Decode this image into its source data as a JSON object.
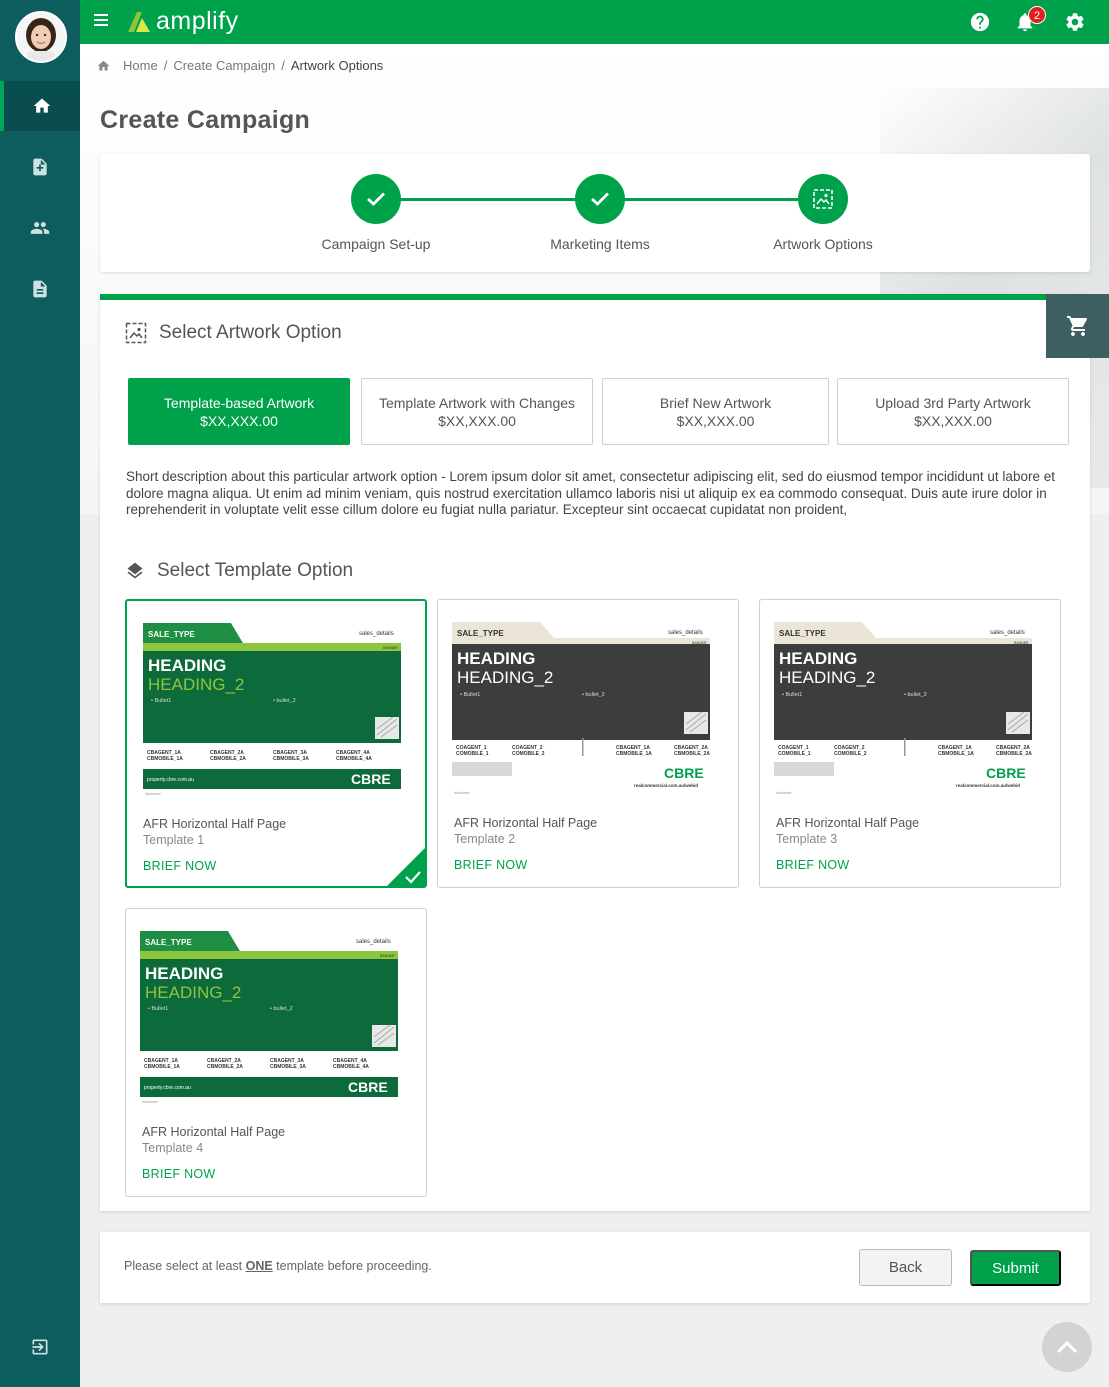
{
  "app": {
    "logo_text": "amplify"
  },
  "header": {
    "notification_count": "2"
  },
  "breadcrumb": {
    "home": "Home",
    "create": "Create Campaign",
    "current": "Artwork Options"
  },
  "page": {
    "title": "Create Campaign"
  },
  "stepper": {
    "steps": [
      {
        "label": "Campaign Set-up",
        "status": "complete"
      },
      {
        "label": "Marketing Items",
        "status": "complete"
      },
      {
        "label": "Artwork Options",
        "status": "active"
      }
    ]
  },
  "artwork_section": {
    "title": "Select Artwork Option",
    "options": [
      {
        "label": "Template-based Artwork",
        "price": "$XX,XXX.00",
        "selected": true
      },
      {
        "label": "Template Artwork with Changes",
        "price": "$XX,XXX.00",
        "selected": false
      },
      {
        "label": "Brief New Artwork",
        "price": "$XX,XXX.00",
        "selected": false
      },
      {
        "label": "Upload 3rd Party Artwork",
        "price": "$XX,XXX.00",
        "selected": false
      }
    ],
    "description": "Short description about this particular artwork option - Lorem ipsum dolor sit amet, consectetur adipiscing elit, sed do eiusmod tempor incididunt ut labore et dolore magna aliqua. Ut enim ad minim veniam, quis nostrud exercitation ullamco laboris nisi ut aliquip ex ea commodo consequat. Duis aute irure dolor in reprehenderit in voluptate velit esse cillum dolore eu fugiat nulla pariatur. Excepteur sint occaecat cupidatat non proident,"
  },
  "template_section": {
    "title": "Select Template Option",
    "templates": [
      {
        "name": "AFR Horizontal Half Page",
        "sub": "Template 1",
        "action": "BRIEF NOW",
        "selected": true,
        "thumb": {
          "sale_type": "SALE_TYPE",
          "sales_details": "sales_details",
          "banner": "BANNER",
          "heading": "HEADING",
          "heading2": "HEADING_2",
          "bullet1": "• Bullet1",
          "bullet2": "• bullet_2",
          "agent1": "CBAGENT_1A",
          "mobile1": "CBMOBILE_1A",
          "agent2": "CBAGENT_2A",
          "mobile2": "CBMOBILE_2A",
          "agent3": "CBAGENT_3A",
          "mobile3": "CBMOBILE_3A",
          "agent4": "CBAGENT_4A",
          "mobile4": "CBMOBILE_4A",
          "url": "property.cbre.com.au",
          "brand": "CBRE",
          "disclaimer": "disclaimer"
        }
      },
      {
        "name": "AFR Horizontal Half Page",
        "sub": "Template 2",
        "action": "BRIEF NOW",
        "selected": false,
        "thumb": {
          "sale_type": "SALE_TYPE",
          "sales_details": "sales_details",
          "banner": "BANNER",
          "heading": "HEADING",
          "heading2": "HEADING_2",
          "bullet1": "• Bullet1",
          "bullet2": "• bullet_2",
          "agent1": "COAGENT_1",
          "mobile1": "COMOBILE_1",
          "agent2": "COAGENT_2",
          "mobile2": "COMOBILE_2",
          "agent3": "CBAGENT_1A",
          "mobile3": "CBMOBILE_1A",
          "agent4": "CBAGENT_2A",
          "mobile4": "CBMOBILE_2A",
          "url": "realcommercial.com.au/webid",
          "brand": "CBRE",
          "disclaimer": "disclaimer"
        }
      },
      {
        "name": "AFR Horizontal Half Page",
        "sub": "Template 3",
        "action": "BRIEF NOW",
        "selected": false,
        "thumb": {
          "sale_type": "SALE_TYPE",
          "sales_details": "sales_details",
          "banner": "BANNER",
          "heading": "HEADING",
          "heading2": "HEADING_2",
          "bullet1": "• Bullet1",
          "bullet2": "• bullet_2",
          "agent1": "COAGENT_1",
          "mobile1": "COMOBILE_1",
          "agent2": "COAGENT_2",
          "mobile2": "COMOBILE_2",
          "agent3": "CBAGENT_1A",
          "mobile3": "CBMOBILE_1A",
          "agent4": "CBAGENT_2A",
          "mobile4": "CBMOBILE_2A",
          "url": "realcommercial.com.au/webid",
          "brand": "CBRE",
          "disclaimer": "disclaimer"
        }
      },
      {
        "name": "AFR Horizontal Half Page",
        "sub": "Template 4",
        "action": "BRIEF NOW",
        "selected": false,
        "thumb": {
          "sale_type": "SALE_TYPE",
          "sales_details": "sales_details",
          "banner": "BANNER",
          "heading": "HEADING",
          "heading2": "HEADING_2",
          "bullet1": "• Bullet1",
          "bullet2": "• bullet_2",
          "agent1": "CBAGENT_1A",
          "mobile1": "CBMOBILE_1A",
          "agent2": "CBAGENT_2A",
          "mobile2": "CBMOBILE_2A",
          "agent3": "CBAGENT_3A",
          "mobile3": "CBMOBILE_3A",
          "agent4": "CBAGENT_4A",
          "mobile4": "CBMOBILE_4A",
          "url": "property.cbre.com.au",
          "brand": "CBRE",
          "disclaimer": "disclaimer"
        }
      }
    ]
  },
  "footer": {
    "hint_before": "Please select at least ",
    "hint_em": "ONE",
    "hint_after": " template before proceeding.",
    "back_label": "Back",
    "submit_label": "Submit"
  },
  "colors": {
    "brand_green": "#00a14b",
    "sidebar": "#0d5c5e",
    "dark_panel": "#3d3d3d",
    "cart_tab": "#3d5f62"
  },
  "icons": [
    "menu-icon",
    "home-icon",
    "add-document-icon",
    "people-icon",
    "document-icon",
    "logout-icon",
    "help-icon",
    "bell-icon",
    "gear-icon",
    "check-icon",
    "image-icon",
    "cart-icon",
    "layers-icon",
    "chevron-up-icon"
  ]
}
